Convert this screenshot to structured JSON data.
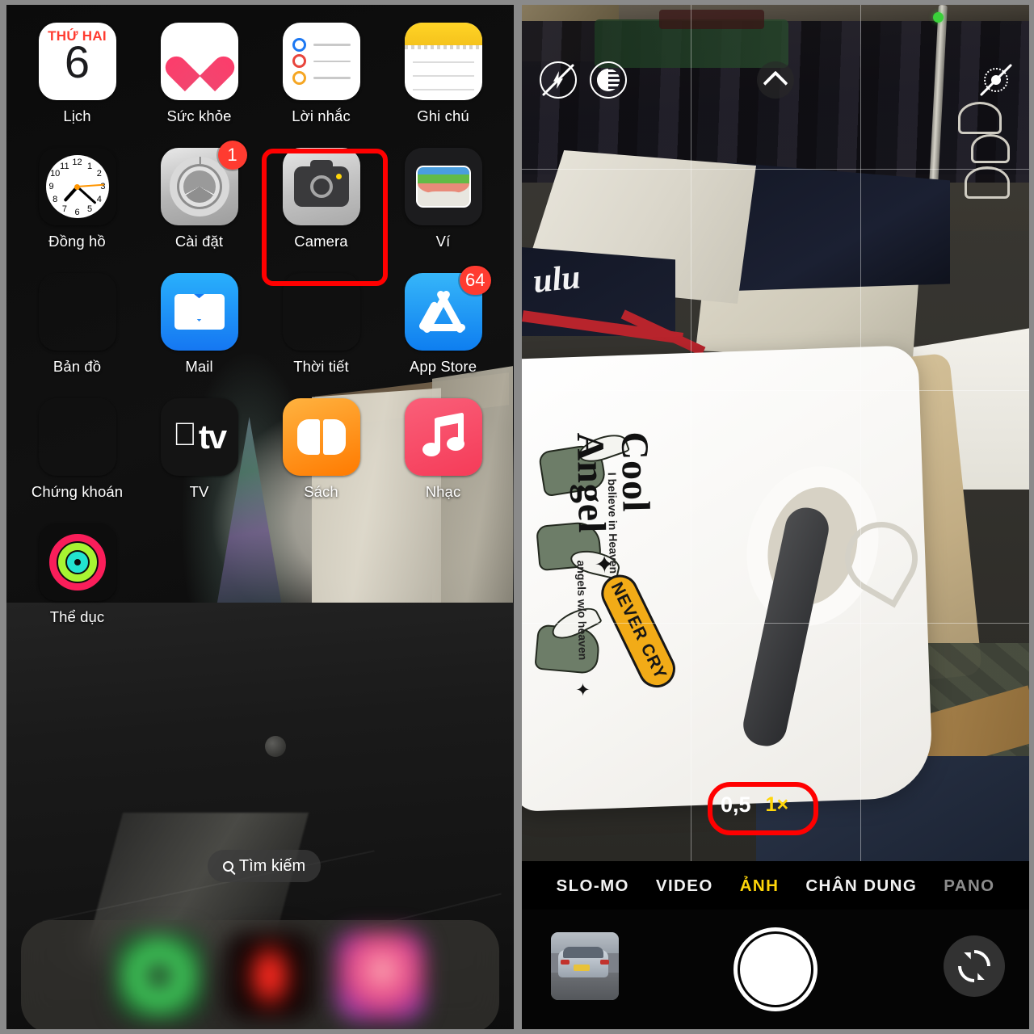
{
  "left_panel": {
    "name": "ios-home-screen",
    "apps": [
      {
        "label": "Lịch",
        "icon": "calendar-icon",
        "badge": null,
        "cal_weekday": "THỨ HAI",
        "cal_day": "6"
      },
      {
        "label": "Sức khỏe",
        "icon": "health-heart-icon",
        "badge": null
      },
      {
        "label": "Lời nhắc",
        "icon": "reminders-icon",
        "badge": null
      },
      {
        "label": "Ghi chú",
        "icon": "notes-icon",
        "badge": null
      },
      {
        "label": "Đồng hồ",
        "icon": "clock-icon",
        "badge": null
      },
      {
        "label": "Cài đặt",
        "icon": "settings-gear-icon",
        "badge": "1"
      },
      {
        "label": "Camera",
        "icon": "camera-icon",
        "badge": null,
        "highlighted": true
      },
      {
        "label": "Ví",
        "icon": "wallet-icon",
        "badge": null
      },
      {
        "label": "Bản đồ",
        "icon": "maps-icon",
        "badge": null
      },
      {
        "label": "Mail",
        "icon": "mail-envelope-icon",
        "badge": null
      },
      {
        "label": "Thời tiết",
        "icon": "weather-icon",
        "badge": null
      },
      {
        "label": "App Store",
        "icon": "app-store-icon",
        "badge": "64"
      },
      {
        "label": "Chứng khoán",
        "icon": "stocks-icon",
        "badge": null
      },
      {
        "label": "TV",
        "icon": "apple-tv-icon",
        "badge": null
      },
      {
        "label": "Sách",
        "icon": "books-icon",
        "badge": null
      },
      {
        "label": "Nhạc",
        "icon": "music-note-icon",
        "badge": null
      },
      {
        "label": "Thể dục",
        "icon": "fitness-rings-icon",
        "badge": null
      }
    ],
    "search": {
      "label": "Tìm kiếm",
      "icon": "search-icon"
    },
    "dock": [
      {
        "name": "dock-app-green",
        "icon": "blurred-green-app-icon"
      },
      {
        "name": "dock-app-red",
        "icon": "blurred-red-app-icon"
      },
      {
        "name": "dock-app-purple",
        "icon": "blurred-gradient-app-icon"
      }
    ],
    "highlight_color": "#ff0000",
    "highlight_target": "Camera"
  },
  "right_panel": {
    "name": "ios-camera-app",
    "top_controls": [
      {
        "name": "flash-off-icon",
        "label": "flash-off"
      },
      {
        "name": "night-mode-icon",
        "label": "night-mode"
      },
      {
        "name": "chevron-up-icon",
        "label": "more-controls"
      },
      {
        "name": "live-photo-off-icon",
        "label": "live-photo-off"
      }
    ],
    "privacy_indicator": {
      "name": "camera-in-use-green-dot",
      "color": "#3ad23a"
    },
    "grid_overlay": true,
    "zoom": {
      "options": [
        "0,5",
        "1×"
      ],
      "selected": "1×",
      "highlighted": "0,5",
      "selected_color": "#ffd60a",
      "highlight_color": "#ff0000"
    },
    "modes": [
      {
        "label": "SLO-MO",
        "state": "normal"
      },
      {
        "label": "VIDEO",
        "state": "normal"
      },
      {
        "label": "ẢNH",
        "state": "active"
      },
      {
        "label": "CHÂN DUNG",
        "state": "normal"
      },
      {
        "label": "PANO",
        "state": "dim"
      }
    ],
    "bottom_bar": {
      "thumbnail": {
        "name": "last-photo-thumbnail",
        "subject": "silver-car"
      },
      "shutter": {
        "name": "shutter-button"
      },
      "flip": {
        "name": "flip-camera-icon"
      }
    },
    "scene": {
      "tshirt_print_title": "Cool Angel",
      "tshirt_print_badge": "NEVER CRY",
      "tshirt_print_line1": "I believe in Heaven",
      "tshirt_print_line2": "angels w/o heaven"
    }
  }
}
